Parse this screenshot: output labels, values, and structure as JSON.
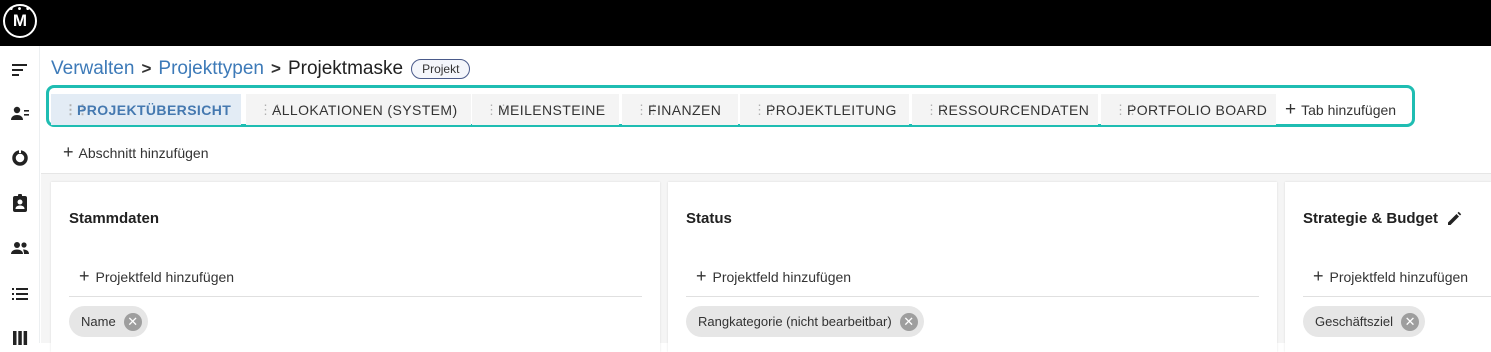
{
  "app": {
    "logo_text": "M"
  },
  "breadcrumb": {
    "items": [
      "Verwalten",
      "Projekttypen"
    ],
    "current": "Projektmaske",
    "separator": ">",
    "type_chip": "Projekt"
  },
  "tabs": [
    {
      "label": "PROJEKTÜBERSICHT",
      "active": true
    },
    {
      "label": "ALLOKATIONEN (SYSTEM)",
      "active": false
    },
    {
      "label": "MEILENSTEINE",
      "active": false
    },
    {
      "label": "FINANZEN",
      "active": false
    },
    {
      "label": "PROJEKTLEITUNG",
      "active": false
    },
    {
      "label": "RESSOURCENDATEN",
      "active": false
    },
    {
      "label": "PORTFOLIO BOARD",
      "active": false
    }
  ],
  "add_tab_label": "Tab hinzufügen",
  "add_section_label": "Abschnitt hinzufügen",
  "add_field_label": "Projektfeld hinzufügen",
  "cards": [
    {
      "title": "Stammdaten",
      "field": "Name",
      "editable": false
    },
    {
      "title": "Status",
      "field": "Rangkategorie (nicht bearbeitbar)",
      "editable": false
    },
    {
      "title": "Strategie & Budget",
      "field": "Geschäftsziel",
      "editable": true
    }
  ],
  "colors": {
    "highlight": "#1fbdb2",
    "link": "#3d7ab8",
    "active_tab_bg": "#e3ecf5"
  },
  "sidebar_icons": [
    "menu-icon",
    "user-list-icon",
    "pie-chart-icon",
    "clipboard-user-icon",
    "people-icon",
    "list-icon",
    "columns-icon"
  ]
}
